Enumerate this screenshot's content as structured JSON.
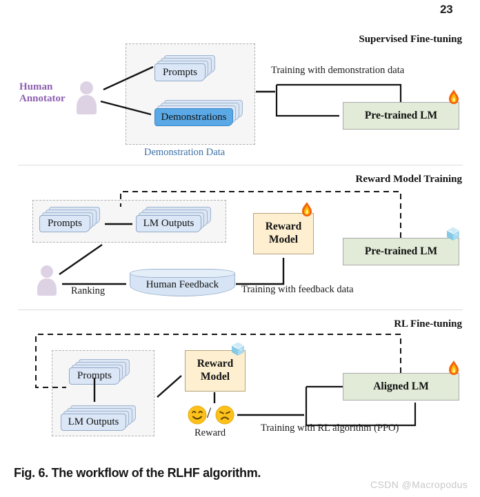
{
  "page": {
    "number": "23",
    "caption": "Fig. 6. The workflow of the RLHF algorithm.",
    "watermark": "CSDN @Macropodus"
  },
  "colors": {
    "background": "#ffffff",
    "group_fill": "#f6f6f6",
    "group_border": "#b0b0b0",
    "card_fill": "#dce6f4",
    "card_border": "#9fb4cf",
    "card_highlight": "#5aa9e6",
    "model_green": "#e1ebd7",
    "model_cream": "#fdefd0",
    "cylinder_fill": "#d6e4f5",
    "person_fill": "#ddd2e4",
    "annotator_text": "#8c5fb0",
    "group_caption_text": "#3b6ea5",
    "divider": "#dcdcdc",
    "watermark_text": "#c8c8c8",
    "stroke": "#111111"
  },
  "stages": [
    {
      "id": "supervised-fine-tuning",
      "title": "Supervised Fine-tuning",
      "annotator": {
        "line1": "Human",
        "line2": "Annotator",
        "icon": "person-icon"
      },
      "group": {
        "caption": "Demonstration Data",
        "cards": [
          {
            "label": "Prompts",
            "highlighted": false
          },
          {
            "label": "Demonstrations",
            "highlighted": true
          }
        ]
      },
      "edge_label": "Training with demonstration data",
      "model": {
        "label": "Pre-trained LM",
        "fill": "green",
        "state_icon": "fire-icon"
      }
    },
    {
      "id": "reward-model-training",
      "title": "Reward Model Training",
      "group": {
        "caption": "",
        "cards": [
          {
            "label": "Prompts",
            "highlighted": false
          },
          {
            "label": "LM Outputs",
            "highlighted": false
          }
        ]
      },
      "person_icon": "person-icon",
      "ranking_label": "Ranking",
      "feedback_store": "Human Feedback",
      "edge_label": "Training with feedback data",
      "reward_model": {
        "line1": "Reward",
        "line2": "Model",
        "fill": "cream",
        "state_icon": "fire-icon"
      },
      "model": {
        "label": "Pre-trained LM",
        "fill": "green",
        "state_icon": "ice-icon"
      }
    },
    {
      "id": "rl-fine-tuning",
      "title": "RL Fine-tuning",
      "group": {
        "caption": "",
        "cards": [
          {
            "label": "Prompts",
            "highlighted": false
          },
          {
            "label": "LM Outputs",
            "highlighted": false
          }
        ]
      },
      "reward_model": {
        "line1": "Reward",
        "line2": "Model",
        "fill": "cream",
        "state_icon": "ice-icon"
      },
      "reward_signal": {
        "label": "Reward",
        "positive_icon": "smiling-face-icon",
        "separator": "/",
        "negative_icon": "sad-face-icon"
      },
      "edge_label": "Training with RL algorithm (PPO)",
      "model": {
        "label": "Aligned LM",
        "fill": "green",
        "state_icon": "fire-icon"
      }
    }
  ]
}
